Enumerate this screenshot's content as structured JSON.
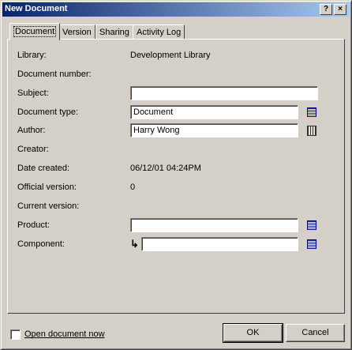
{
  "window": {
    "title": "New Document"
  },
  "titlebar_buttons": {
    "help": "?",
    "close": "×"
  },
  "tabs": [
    {
      "label": "Document",
      "active": true
    },
    {
      "label": "Version"
    },
    {
      "label": "Sharing"
    },
    {
      "label": "Activity Log"
    }
  ],
  "fields": {
    "library": {
      "label": "Library:",
      "value": "Development Library"
    },
    "document_number": {
      "label": "Document number:"
    },
    "subject": {
      "label": "Subject:",
      "value": ""
    },
    "document_type": {
      "label": "Document type:",
      "value": "Document"
    },
    "author": {
      "label": "Author:",
      "value": "Harry Wong"
    },
    "creator": {
      "label": "Creator:"
    },
    "date_created": {
      "label": "Date created:",
      "value": "06/12/01 04:24PM"
    },
    "official_version": {
      "label": "Official version:",
      "value": "0"
    },
    "current_version": {
      "label": "Current version:"
    },
    "product": {
      "label": "Product:",
      "value": ""
    },
    "component": {
      "label": "Component:",
      "value": "",
      "arrow": "↳"
    }
  },
  "footer": {
    "open_document_now": "Open document now",
    "ok": "OK",
    "cancel": "Cancel"
  },
  "icons": {
    "list_button": "list-icon",
    "address_book": "address-book-icon"
  }
}
